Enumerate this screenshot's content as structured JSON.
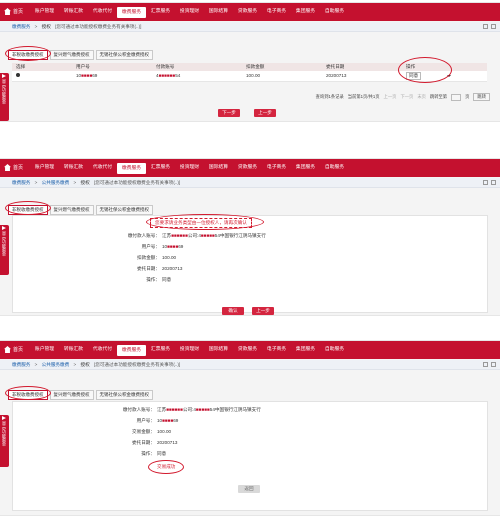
{
  "nav": {
    "home": "首页",
    "menu": [
      "账户管理",
      "转账汇款",
      "代收代付",
      "缴费服务",
      "汇票服务",
      "投资理财",
      "国际结算",
      "贷款服务",
      "电子商务",
      "集团服务",
      "自助服务"
    ],
    "active_index": 4
  },
  "breadcrumb": {
    "home": "缴费服务",
    "section": "公共服务缴费",
    "page": "授权",
    "tip": "[您可通过本功能授权缴费业务有关事项(..)]"
  },
  "tabs": [
    "非税收缴费授权",
    "复兴燃气缴费授权",
    "无锡社保公积金缴费授权"
  ],
  "side_label": "显示功能菜单",
  "screen1": {
    "columns": [
      "选择",
      "用户号",
      "付款账号",
      "扣款金额",
      "委托日期",
      "操作"
    ],
    "row": {
      "user_no_prefix": "10",
      "user_no_suffix": "69",
      "account_prefix": "4",
      "account_suffix": "54",
      "amount": "100.00",
      "date": "20200713",
      "action": "同意"
    },
    "pager": {
      "summary": "查询到1条记录",
      "current": "当前第1页/共1页",
      "first": "上一页",
      "next": "下一页",
      "last": "末页",
      "jump_label": "跳转至第",
      "page_label": "页",
      "go": "跳转"
    },
    "buttons": {
      "next": "下一步",
      "prev": "上一步"
    }
  },
  "screen2": {
    "notice": "您要求请业务类型由一位授权人，请再次确认",
    "fields": [
      {
        "label": "缴付款人账号：",
        "value_prefix": "江苏",
        "value_mid": "公司:4",
        "value_suffix": "54中国银行江阴马镇支行"
      },
      {
        "label": "用户号：",
        "value_prefix": "10",
        "value_mid": "",
        "value_suffix": "69"
      },
      {
        "label": "扣款金额：",
        "value_prefix": "100.00",
        "value_mid": "",
        "value_suffix": ""
      },
      {
        "label": "委托日期：",
        "value_prefix": "20200713",
        "value_mid": "",
        "value_suffix": ""
      },
      {
        "label": "操作：",
        "value_prefix": "同意",
        "value_mid": "",
        "value_suffix": ""
      }
    ],
    "buttons": {
      "confirm": "确认",
      "prev": "上一步"
    }
  },
  "screen3": {
    "fields": [
      {
        "label": "缴付款人账号：",
        "value_prefix": "江苏",
        "value_mid": "公司:4",
        "value_suffix": "54中国银行江阴马镇支行"
      },
      {
        "label": "用户号：",
        "value_prefix": "10",
        "value_mid": "",
        "value_suffix": "69"
      },
      {
        "label": "交易金额：",
        "value_prefix": "100.00",
        "value_mid": "",
        "value_suffix": ""
      },
      {
        "label": "委托日期：",
        "value_prefix": "20200713",
        "value_mid": "",
        "value_suffix": ""
      },
      {
        "label": "操作：",
        "value_prefix": "同意",
        "value_mid": "",
        "value_suffix": ""
      }
    ],
    "status": "交易成功",
    "buttons": {
      "back": "返回"
    }
  },
  "colors": {
    "brand": "#c4112f",
    "highlight": "#d21a2e",
    "link": "#1b5faa"
  }
}
